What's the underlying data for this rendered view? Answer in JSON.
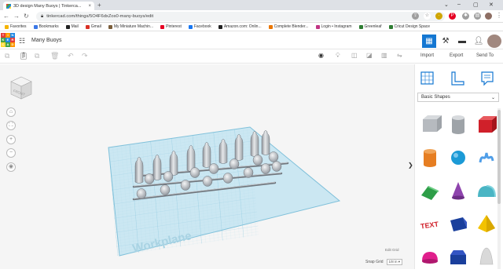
{
  "browser": {
    "tab_title": "3D design Many Buoys | Tinkerca...",
    "tab_close": "×",
    "new_tab": "+",
    "url": "tinkercad.com/things/5O4F6dxZos0-many-buoys/edit",
    "window_controls": [
      "⌄",
      "–",
      "▢",
      "✕"
    ],
    "bookmarks": [
      {
        "label": "Favorites",
        "icon": "folder-icon",
        "color": "#f5b400"
      },
      {
        "label": "Bookmarks",
        "icon": "star-icon",
        "color": "#3b78e7"
      },
      {
        "label": "Mail",
        "icon": "mail-icon",
        "color": "#222222"
      },
      {
        "label": "Gmail",
        "icon": "gmail-icon",
        "color": "#d93025"
      },
      {
        "label": "My Miniature Machin...",
        "icon": "machine-icon",
        "color": "#7b5e3b"
      },
      {
        "label": "Pinterest",
        "icon": "pinterest-icon",
        "color": "#e60023"
      },
      {
        "label": "Facebook",
        "icon": "facebook-icon",
        "color": "#1877f2"
      },
      {
        "label": "Amazon.com: Onlin...",
        "icon": "amazon-icon",
        "color": "#222222"
      },
      {
        "label": "Complete Blender...",
        "icon": "blender-icon",
        "color": "#ea7600"
      },
      {
        "label": "Login • Instagram",
        "icon": "instagram-icon",
        "color": "#c13584"
      },
      {
        "label": "Greenleaf",
        "icon": "greenleaf-icon",
        "color": "#2e7d32"
      },
      {
        "label": "Cricut Design Space",
        "icon": "cricut-icon",
        "color": "#2e7d32"
      }
    ]
  },
  "app": {
    "logo_letters": [
      "TIN",
      "KER",
      "CAD"
    ],
    "design_name": "Many Buoys",
    "accent": "#1477d2"
  },
  "toolbar": {
    "right_actions": [
      "Import",
      "Export",
      "Send To"
    ]
  },
  "workspace": {
    "workplane_label": "Workplane",
    "edit_grid": "Edit Grid",
    "snap_grid_label": "Snap Grid",
    "snap_grid_value": "1/8 in",
    "viewcube_label": "FRONT",
    "view_controls": [
      "⌂",
      "⛶",
      "+",
      "−",
      "◉"
    ],
    "panel_toggle": "❯"
  },
  "shapes_panel": {
    "category": "Basic Shapes",
    "shapes": [
      {
        "name": "box-hole",
        "color": "#9ea3a8"
      },
      {
        "name": "cylinder-hole",
        "color": "#9ea3a8"
      },
      {
        "name": "box",
        "color": "#d0202a"
      },
      {
        "name": "cylinder",
        "color": "#e67e22"
      },
      {
        "name": "sphere",
        "color": "#1b9ad6"
      },
      {
        "name": "scribble",
        "color": "#4f9ee8"
      },
      {
        "name": "roof",
        "color": "#2e9e48"
      },
      {
        "name": "cone",
        "color": "#8e44ad"
      },
      {
        "name": "round-roof",
        "color": "#4ab5c4"
      },
      {
        "name": "text",
        "color": "#d0202a"
      },
      {
        "name": "wedge",
        "color": "#1a3f9c"
      },
      {
        "name": "pyramid",
        "color": "#f3c200"
      },
      {
        "name": "half-sphere",
        "color": "#e01f8c"
      },
      {
        "name": "polygon",
        "color": "#1a3f9c"
      },
      {
        "name": "paraboloid",
        "color": "#d9d9d9"
      }
    ]
  }
}
